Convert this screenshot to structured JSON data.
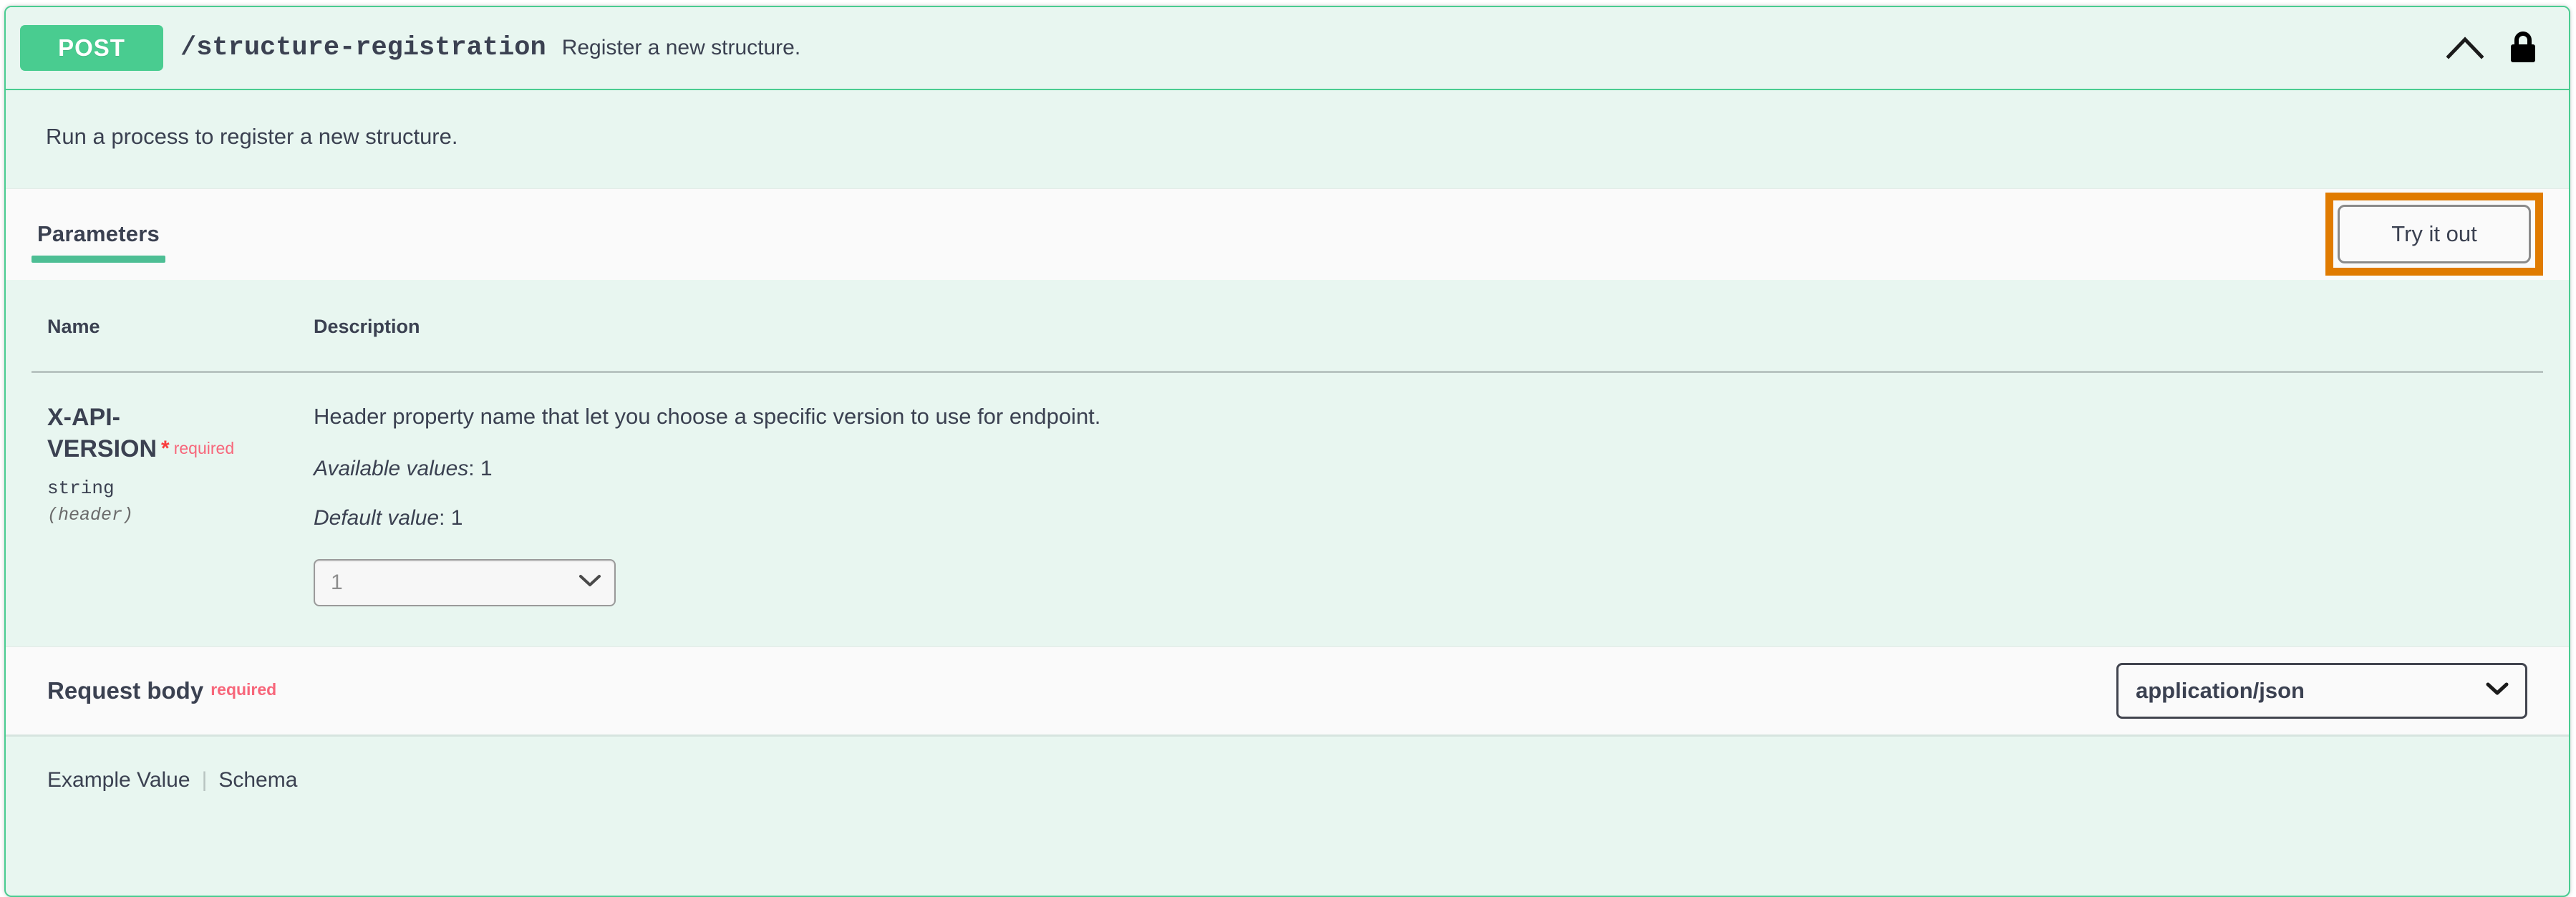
{
  "operation": {
    "method": "POST",
    "path": "/structure-registration",
    "summary": "Register a new structure.",
    "description": "Run a process to register a new structure.",
    "collapse_icon": "chevron-up-icon",
    "auth_icon": "lock-icon",
    "method_color": "#49cc90",
    "block_border_color": "#49cc90",
    "block_background": "#e8f6f0"
  },
  "tabs": {
    "parameters_label": "Parameters",
    "active": "Parameters",
    "underline_color": "#4dbe94"
  },
  "actions": {
    "try_it_out_label": "Try it out",
    "annotation_color": "#e07b00"
  },
  "parameters_table": {
    "headers": {
      "name": "Name",
      "description": "Description"
    },
    "rows": [
      {
        "name": "X-API-VERSION",
        "required_star": "*",
        "required_label": "required",
        "type": "string",
        "in": "(header)",
        "description": "Header property name that let you choose a specific version to use for endpoint.",
        "available_values_key": "Available values",
        "available_values": ": 1",
        "default_value_key": "Default value",
        "default_value": ": 1",
        "select_value": "1",
        "select_options": [
          "1"
        ],
        "dropdown_icon": "chevron-down-icon"
      }
    ]
  },
  "request_body": {
    "title": "Request body",
    "required_label": "required",
    "content_type_value": "application/json",
    "content_type_options": [
      "application/json"
    ],
    "dropdown_icon": "chevron-down-icon"
  },
  "example_tabs": {
    "example_value": "Example Value",
    "separator": "|",
    "schema": "Schema"
  }
}
